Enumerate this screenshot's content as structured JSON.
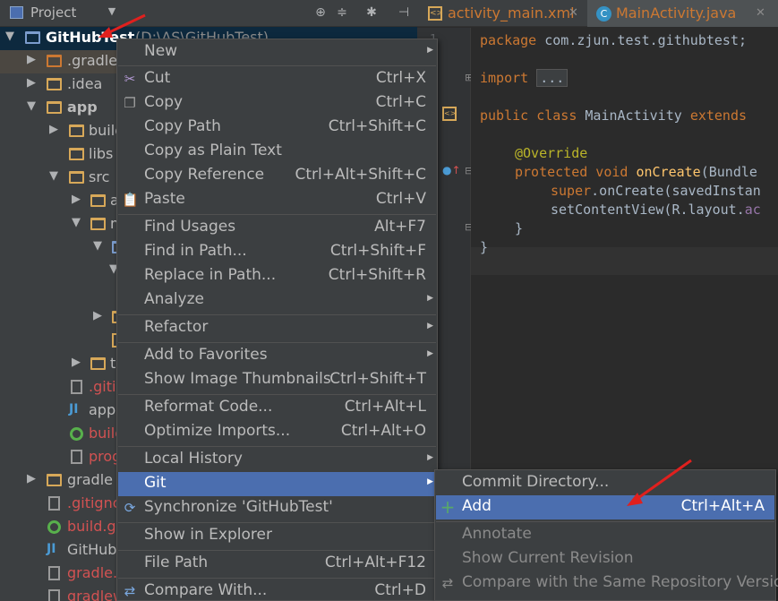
{
  "project_panel": {
    "title": "Project",
    "tree": [
      {
        "label": "GitHubTest",
        "suffix": "(D:\\AS\\GitHubTest)"
      },
      {
        "label": ".gradle"
      },
      {
        "label": ".idea"
      },
      {
        "label": "app"
      },
      {
        "label": "build"
      },
      {
        "label": "libs"
      },
      {
        "label": "src"
      },
      {
        "label": "a"
      },
      {
        "label": "m"
      },
      {
        "label": "te"
      },
      {
        "label": ".gitig"
      },
      {
        "label": "app."
      },
      {
        "label": "build"
      },
      {
        "label": "prog"
      },
      {
        "label": "gradle"
      },
      {
        "label": ".gitigno"
      },
      {
        "label": "build.gr"
      },
      {
        "label": "GitHubT"
      },
      {
        "label": "gradle.p"
      },
      {
        "label": "gradlew"
      }
    ]
  },
  "editor": {
    "tabs": [
      {
        "label": "activity_main.xml"
      },
      {
        "label": "MainActivity.java"
      }
    ],
    "code": {
      "l1_kw": "package",
      "l1_rest": " com.zjun.test.githubtest;",
      "l2_kw": "import",
      "l2_fold": "...",
      "l3_kw": "public class",
      "l3_name": " MainActivity ",
      "l3_ext": "extends",
      "l4_ann": "@Override",
      "l5_kw": "protected void",
      "l5_fn": " onCreate",
      "l5_rest": "(Bundle",
      "l6_kw": "super",
      "l6_rest": ".onCreate(savedInstan",
      "l7_a": "setContentView(R.layout.",
      "l7_b": "ac",
      "l8": "}",
      "l9": "}"
    }
  },
  "context_menu": {
    "items": [
      {
        "label": "New",
        "shortcut": ""
      },
      {
        "label": "Cut",
        "shortcut": "Ctrl+X"
      },
      {
        "label": "Copy",
        "shortcut": "Ctrl+C"
      },
      {
        "label": "Copy Path",
        "shortcut": "Ctrl+Shift+C"
      },
      {
        "label": "Copy as Plain Text",
        "shortcut": ""
      },
      {
        "label": "Copy Reference",
        "shortcut": "Ctrl+Alt+Shift+C"
      },
      {
        "label": "Paste",
        "shortcut": "Ctrl+V"
      },
      {
        "label": "Find Usages",
        "shortcut": "Alt+F7"
      },
      {
        "label": "Find in Path...",
        "shortcut": "Ctrl+Shift+F"
      },
      {
        "label": "Replace in Path...",
        "shortcut": "Ctrl+Shift+R"
      },
      {
        "label": "Analyze",
        "shortcut": ""
      },
      {
        "label": "Refactor",
        "shortcut": ""
      },
      {
        "label": "Add to Favorites",
        "shortcut": ""
      },
      {
        "label": "Show Image Thumbnails",
        "shortcut": "Ctrl+Shift+T"
      },
      {
        "label": "Reformat Code...",
        "shortcut": "Ctrl+Alt+L"
      },
      {
        "label": "Optimize Imports...",
        "shortcut": "Ctrl+Alt+O"
      },
      {
        "label": "Local History",
        "shortcut": ""
      },
      {
        "label": "Git",
        "shortcut": ""
      },
      {
        "label": "Synchronize 'GitHubTest'",
        "shortcut": ""
      },
      {
        "label": "Show in Explorer",
        "shortcut": ""
      },
      {
        "label": "File Path",
        "shortcut": "Ctrl+Alt+F12"
      },
      {
        "label": "Compare With...",
        "shortcut": "Ctrl+D"
      }
    ]
  },
  "git_submenu": {
    "items": [
      {
        "label": "Commit Directory...",
        "shortcut": ""
      },
      {
        "label": "Add",
        "shortcut": "Ctrl+Alt+A"
      },
      {
        "label": "Annotate",
        "shortcut": ""
      },
      {
        "label": "Show Current Revision",
        "shortcut": ""
      },
      {
        "label": "Compare with the Same Repository Version",
        "shortcut": ""
      }
    ]
  },
  "colors": {
    "selection": "#4b6eaf",
    "menu_bg": "#3c3f41",
    "annotation_arrow": "#e0201e",
    "keyword": "#cc7832"
  },
  "icons": {
    "cut": "scissors-icon",
    "copy": "copy-icon",
    "paste": "paste-icon",
    "sync": "sync-icon",
    "compare": "compare-icon",
    "add": "plus-icon"
  }
}
